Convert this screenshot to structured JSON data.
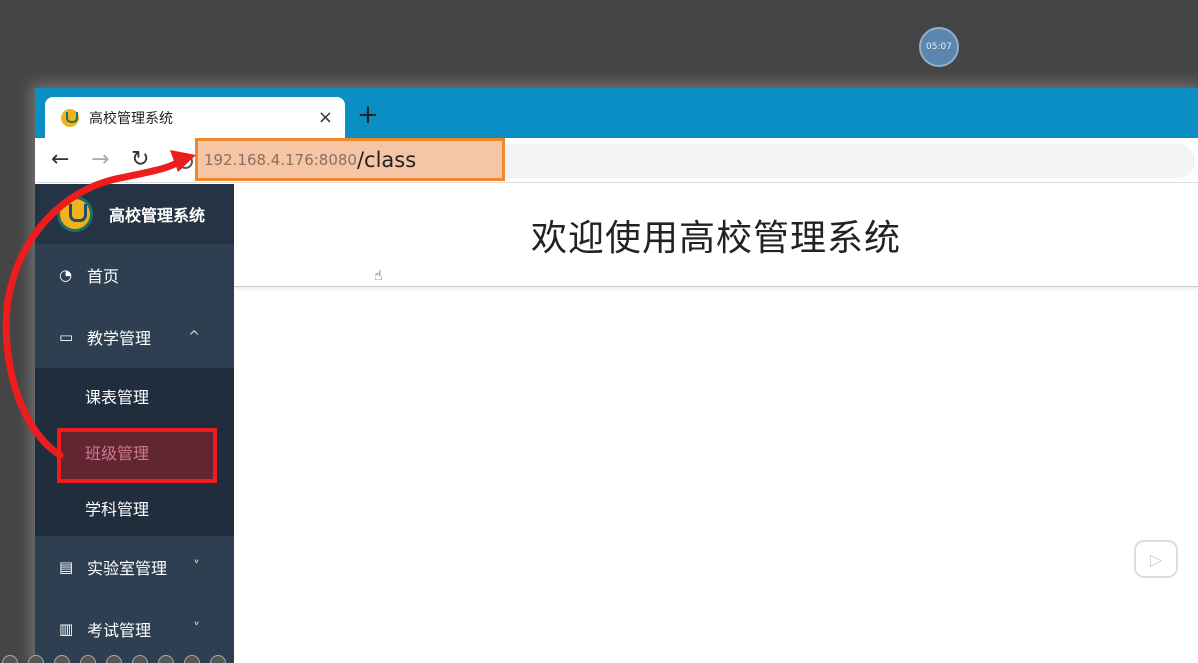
{
  "overlay": {
    "timer": "05:07"
  },
  "tab": {
    "title": "高校管理系统",
    "close": "×",
    "new_tab": "+"
  },
  "toolbar": {
    "back": "←",
    "forward": "→",
    "reload": "↻"
  },
  "address": {
    "host": "192.168.4.176:8080",
    "path": "/class"
  },
  "sidebar": {
    "brand": "高校管理系统",
    "home": "首页",
    "teaching": {
      "label": "教学管理",
      "chevron": "^"
    },
    "sub_items": [
      "课表管理",
      "班级管理",
      "学科管理"
    ],
    "lab": {
      "label": "实验室管理",
      "chevron": "˅"
    },
    "exam": {
      "label": "考试管理",
      "chevron": "˅"
    }
  },
  "main": {
    "welcome": "欢迎使用高校管理系统"
  },
  "colors": {
    "tabbar": "#0a8ec4",
    "sidebar": "#2d3f51",
    "annotation": "#ee1d1d",
    "url_highlight": "#ee8a2c"
  }
}
